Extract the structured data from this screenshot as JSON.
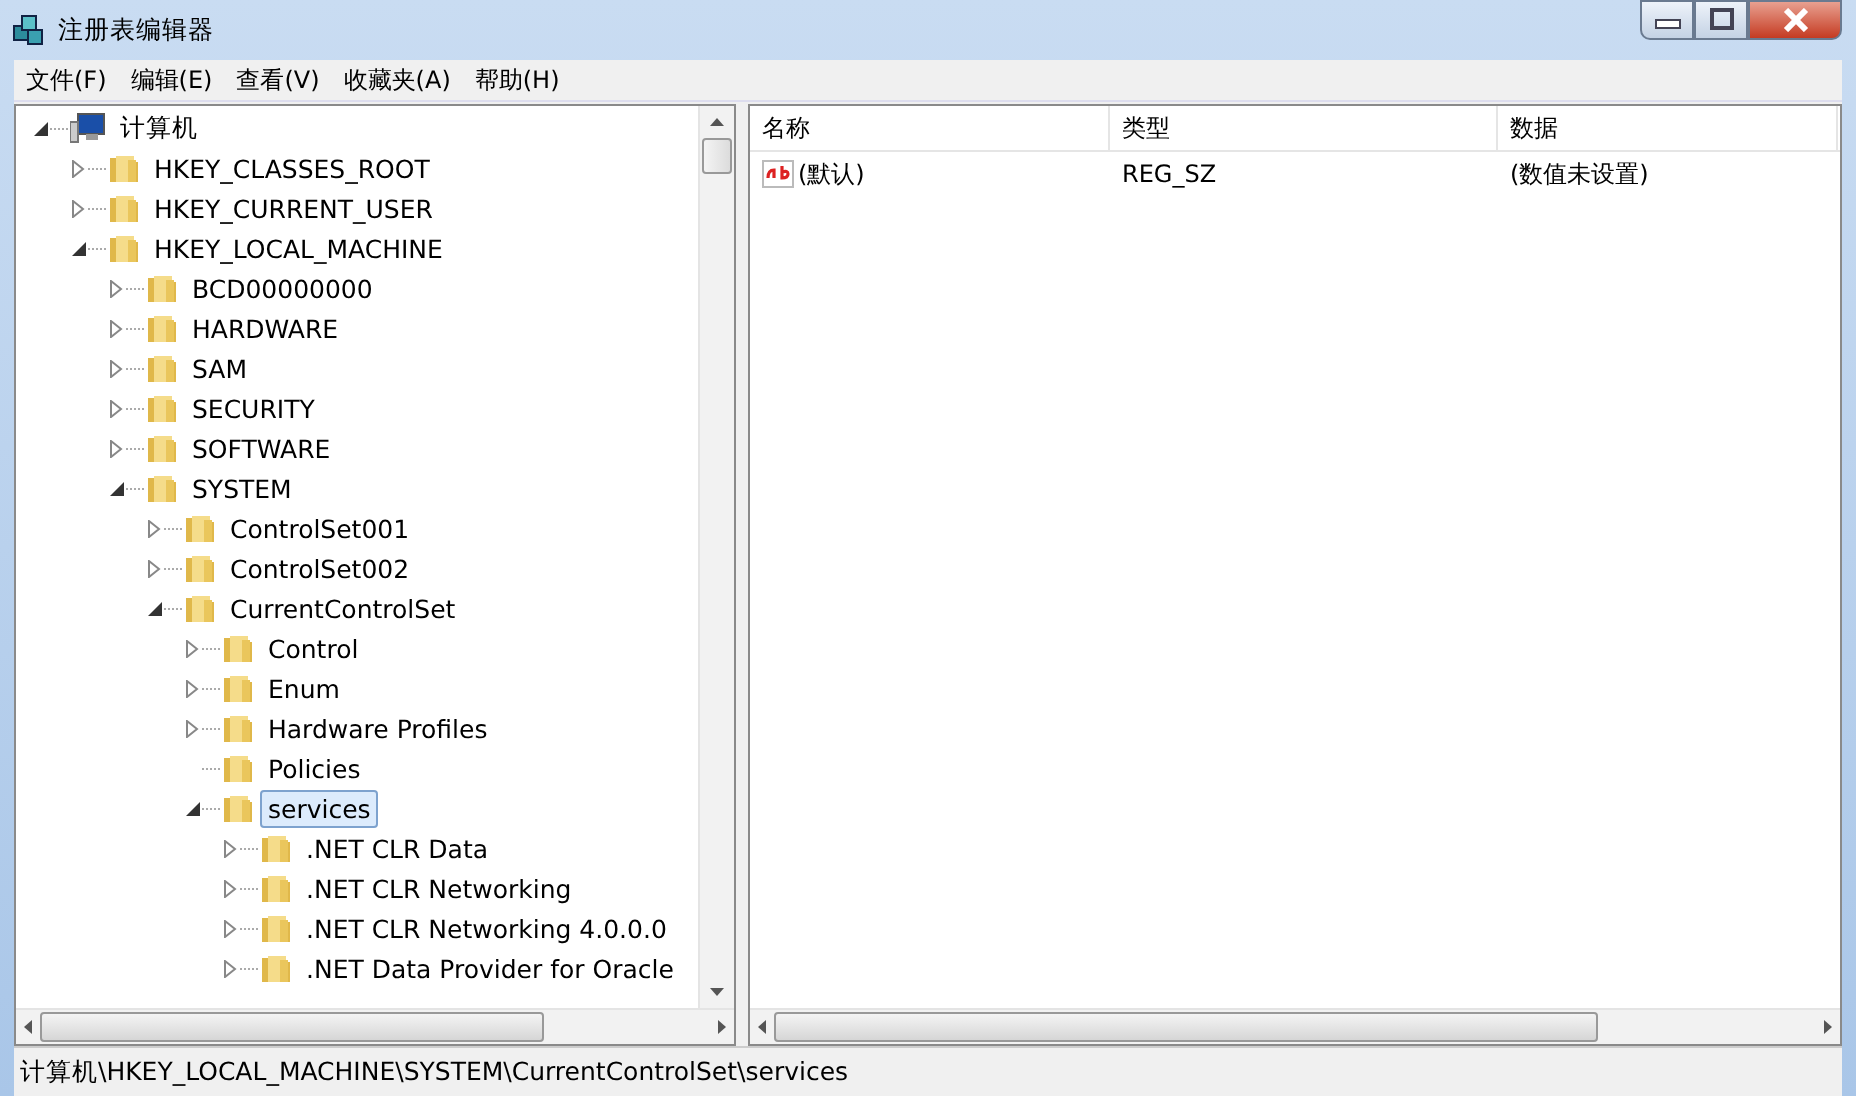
{
  "window": {
    "title": "注册表编辑器"
  },
  "menu": [
    "文件(F)",
    "编辑(E)",
    "查看(V)",
    "收藏夹(A)",
    "帮助(H)"
  ],
  "tree": [
    {
      "label": "计算机",
      "kind": "computer",
      "expandable": true,
      "expanded": true,
      "selected": false,
      "children": [
        {
          "label": "HKEY_CLASSES_ROOT",
          "kind": "folder",
          "expandable": true,
          "expanded": false,
          "selected": false
        },
        {
          "label": "HKEY_CURRENT_USER",
          "kind": "folder",
          "expandable": true,
          "expanded": false,
          "selected": false
        },
        {
          "label": "HKEY_LOCAL_MACHINE",
          "kind": "folder",
          "expandable": true,
          "expanded": true,
          "selected": false,
          "children": [
            {
              "label": "BCD00000000",
              "kind": "folder",
              "expandable": true,
              "expanded": false,
              "selected": false
            },
            {
              "label": "HARDWARE",
              "kind": "folder",
              "expandable": true,
              "expanded": false,
              "selected": false
            },
            {
              "label": "SAM",
              "kind": "folder",
              "expandable": true,
              "expanded": false,
              "selected": false
            },
            {
              "label": "SECURITY",
              "kind": "folder",
              "expandable": true,
              "expanded": false,
              "selected": false
            },
            {
              "label": "SOFTWARE",
              "kind": "folder",
              "expandable": true,
              "expanded": false,
              "selected": false
            },
            {
              "label": "SYSTEM",
              "kind": "folder",
              "expandable": true,
              "expanded": true,
              "selected": false,
              "children": [
                {
                  "label": "ControlSet001",
                  "kind": "folder",
                  "expandable": true,
                  "expanded": false,
                  "selected": false
                },
                {
                  "label": "ControlSet002",
                  "kind": "folder",
                  "expandable": true,
                  "expanded": false,
                  "selected": false
                },
                {
                  "label": "CurrentControlSet",
                  "kind": "folder",
                  "expandable": true,
                  "expanded": true,
                  "selected": false,
                  "children": [
                    {
                      "label": "Control",
                      "kind": "folder",
                      "expandable": true,
                      "expanded": false,
                      "selected": false
                    },
                    {
                      "label": "Enum",
                      "kind": "folder",
                      "expandable": true,
                      "expanded": false,
                      "selected": false
                    },
                    {
                      "label": "Hardware Profiles",
                      "kind": "folder",
                      "expandable": true,
                      "expanded": false,
                      "selected": false
                    },
                    {
                      "label": "Policies",
                      "kind": "folder",
                      "expandable": false,
                      "selected": false
                    },
                    {
                      "label": "services",
                      "kind": "folder",
                      "expandable": true,
                      "expanded": true,
                      "selected": true,
                      "children": [
                        {
                          "label": ".NET CLR Data",
                          "kind": "folder",
                          "expandable": true,
                          "expanded": false,
                          "selected": false
                        },
                        {
                          "label": ".NET CLR Networking",
                          "kind": "folder",
                          "expandable": true,
                          "expanded": false,
                          "selected": false
                        },
                        {
                          "label": ".NET CLR Networking 4.0.0.0",
                          "kind": "folder",
                          "expandable": true,
                          "expanded": false,
                          "selected": false
                        },
                        {
                          "label": ".NET Data Provider for Oracle",
                          "kind": "folder",
                          "expandable": true,
                          "expanded": false,
                          "selected": false
                        }
                      ]
                    }
                  ]
                }
              ]
            }
          ]
        }
      ]
    }
  ],
  "table": {
    "columns": [
      "名称",
      "类型",
      "数据"
    ],
    "rows": [
      {
        "name": "(默认)",
        "type": "REG_SZ",
        "data": "(数值未设置)"
      }
    ]
  },
  "status_bar": "计算机\\HKEY_LOCAL_MACHINE\\SYSTEM\\CurrentControlSet\\services"
}
